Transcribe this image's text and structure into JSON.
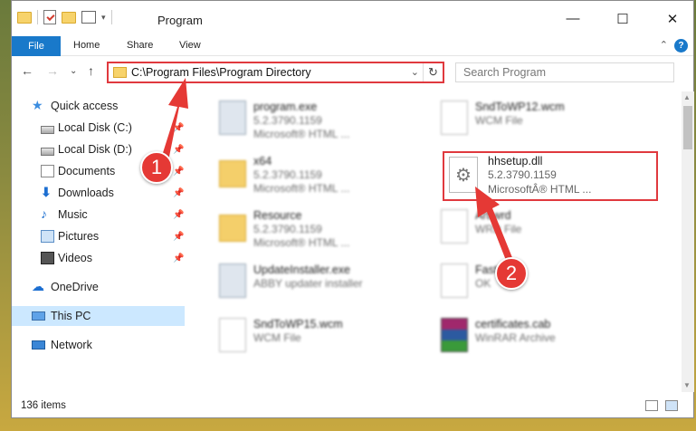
{
  "window": {
    "title": "Program",
    "controls": {
      "minimize": "—",
      "maximize": "☐",
      "close": "✕"
    }
  },
  "ribbon": {
    "tabs": [
      "File",
      "Home",
      "Share",
      "View"
    ],
    "help": "?",
    "collapse": "⌃"
  },
  "nav": {
    "back": "←",
    "forward": "→",
    "recent": "⌄",
    "up": "↑",
    "address": "C:\\Program Files\\Program Directory",
    "address_chevron": "⌄",
    "refresh": "↻",
    "search_placeholder": "Search Program"
  },
  "sidebar": {
    "items": [
      {
        "label": "Quick access",
        "icon": "star-icon"
      },
      {
        "label": "Local Disk (C:)",
        "icon": "disk-icon"
      },
      {
        "label": "Local Disk (D:)",
        "icon": "disk-icon"
      },
      {
        "label": "Documents",
        "icon": "documents-icon"
      },
      {
        "label": "Downloads",
        "icon": "downloads-icon"
      },
      {
        "label": "Music",
        "icon": "music-icon"
      },
      {
        "label": "Pictures",
        "icon": "pictures-icon"
      },
      {
        "label": "Videos",
        "icon": "videos-icon"
      },
      {
        "label": "OneDrive",
        "icon": "cloud-icon"
      },
      {
        "label": "This PC",
        "icon": "computer-icon"
      },
      {
        "label": "Network",
        "icon": "network-icon"
      }
    ],
    "pin_glyph": "📌",
    "star_glyph": "★",
    "download_glyph": "⬇",
    "music_glyph": "♪",
    "cloud_glyph": "☁"
  },
  "files": [
    {
      "name": "program.exe",
      "line1": "5.2.3790.1159",
      "line2": "Microsoft® HTML ..."
    },
    {
      "name": "SndToWP12.wcm",
      "line1": "WCM File",
      "line2": ""
    },
    {
      "name": "x64",
      "line1": "5.2.3790.1159",
      "line2": "Microsoft® HTML ..."
    },
    {
      "name": "Resource",
      "line1": "5.2.3790.1159",
      "line2": "Microsoft® HTML ..."
    },
    {
      "name": "Art.wrd",
      "line1": "WRD File",
      "line2": ""
    },
    {
      "name": "UpdateInstaller.exe",
      "line1": "ABBY updater installer",
      "line2": ""
    },
    {
      "name": "FastLook",
      "line1": "OK",
      "line2": ""
    },
    {
      "name": "SndToWP15.wcm",
      "line1": "WCM File",
      "line2": ""
    },
    {
      "name": "certificates.cab",
      "line1": "WinRAR Archive",
      "line2": ""
    }
  ],
  "highlighted_file": {
    "name": "hhsetup.dll",
    "line1": "5.2.3790.1159",
    "line2": "MicrosoftÂ® HTML ..."
  },
  "scrollbar": {
    "up": "▲",
    "down": "▼"
  },
  "status": {
    "count": "136 items"
  },
  "annotations": {
    "step1": "1",
    "step2": "2",
    "color": "#e53935"
  },
  "colors": {
    "accent": "#1979ca",
    "highlight_border": "#e0393e",
    "selection": "#cce8ff"
  }
}
